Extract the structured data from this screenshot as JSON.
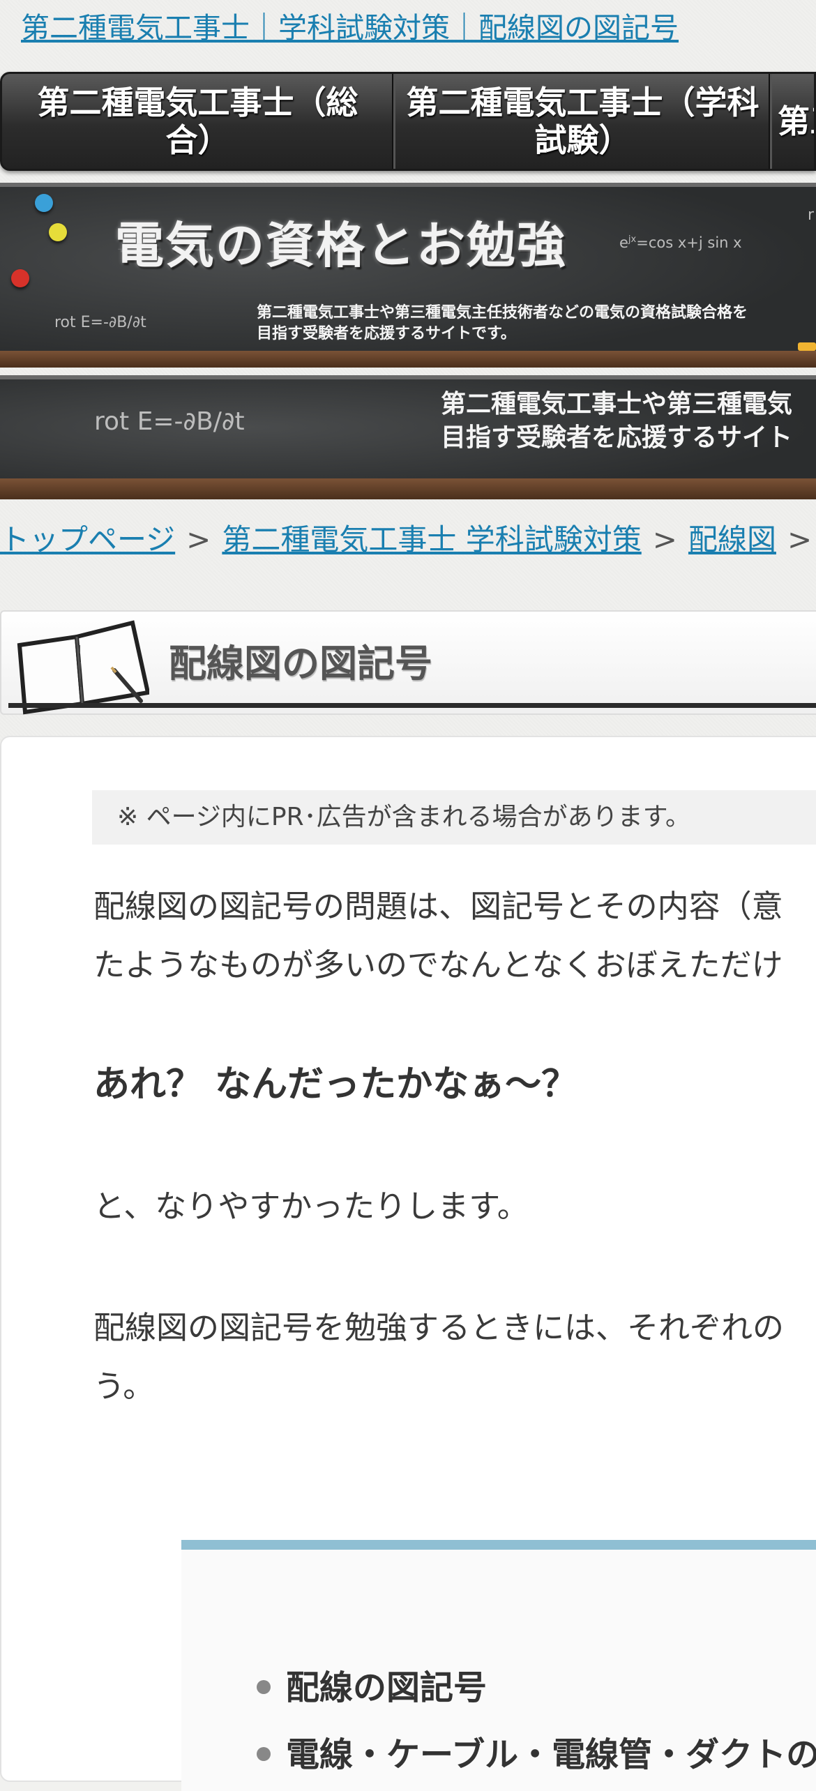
{
  "site_title": "第二種電気工事士｜学科試験対策｜配線図の図記号",
  "nav": {
    "items": [
      {
        "label_line1": "第二種電気工事士（総",
        "label_line2": "合）"
      },
      {
        "label_line1": "第二種電気工事士（学科",
        "label_line2": "試験）"
      },
      {
        "label_line1": "第三",
        "label_line2": ""
      }
    ]
  },
  "banner": {
    "title": "電気の資格とお勉強",
    "formula_left": "rot E=-∂B/∂t",
    "formula_right": "e^jx=cos x+j sin x",
    "formula_right_base": "e",
    "formula_right_sup": "jx",
    "formula_right_rest": "=cos x+j sin x",
    "description_line1": "第二種電気工事士や第三種電気主任技術者などの電気の資格試験合格を",
    "description_line2": "目指す受験者を応援するサイトです。",
    "edge_char": "r"
  },
  "banner2": {
    "formula": "rot E=-∂B/∂t",
    "description_line1": "第二種電気工事士や第三種電気",
    "description_line2": "目指す受験者を応援するサイト"
  },
  "breadcrumb": {
    "items": [
      "トップページ",
      "第二種電気工事士 学科試験対策",
      "配線図"
    ],
    "separator": ">"
  },
  "heading": {
    "title": "配線図の図記号"
  },
  "article": {
    "pr_notice": "※ ページ内にPR･広告が含まれる場合があります。",
    "para1_line1": "配線図の図記号の問題は、図記号とその内容（意",
    "para1_line2": "たようなものが多いのでなんとなくおぼえただけ",
    "emphasis": "あれ？ なんだったかなぁ〜？",
    "para2": "と、なりやすかったりします。",
    "para3_line1": "配線図の図記号を勉強するときには、それぞれの",
    "para3_line2": "う。"
  },
  "toc": {
    "items": [
      "配線の図記号",
      "電線・ケーブル・電線管・ダクトの"
    ]
  },
  "colors": {
    "link": "#1a7fb0",
    "toc_border": "#8fbfd3",
    "magnet_blue": "#3aa0d8",
    "magnet_yellow": "#e6dd3a",
    "magnet_red": "#d8322a"
  }
}
